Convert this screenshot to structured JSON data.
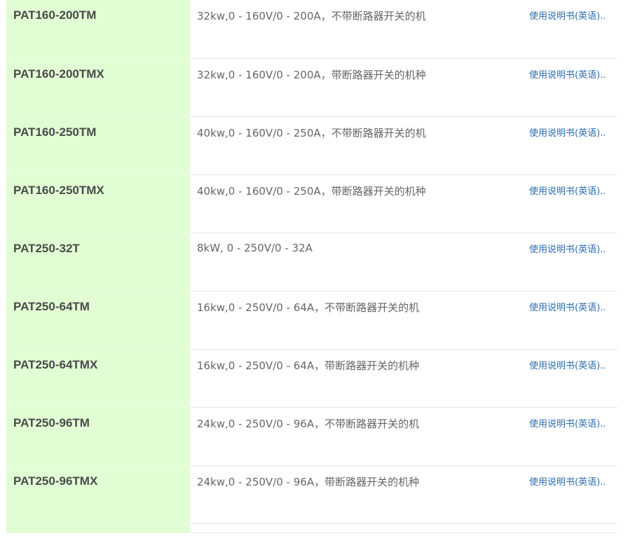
{
  "rows": [
    {
      "model": "PAT160-200TM",
      "spec": "32kw,0 - 160V/0 - 200A，不带断路器开关的机",
      "link": "使用说明书(英语).."
    },
    {
      "model": "PAT160-200TMX",
      "spec": "32kw,0 - 160V/0 - 200A，带断路器开关的机种",
      "link": "使用说明书(英语).."
    },
    {
      "model": "PAT160-250TM",
      "spec": "40kw,0 - 160V/0 - 250A，不带断路器开关的机",
      "link": "使用说明书(英语).."
    },
    {
      "model": "PAT160-250TMX",
      "spec": "40kw,0 - 160V/0 - 250A，带断路器开关的机种",
      "link": "使用说明书(英语).."
    },
    {
      "model": "PAT250-32T",
      "spec": "8kW, 0 - 250V/0 - 32A",
      "link": "使用说明书(英语).."
    },
    {
      "model": "PAT250-64TM",
      "spec": "16kw,0 - 250V/0 - 64A，不带断路器开关的机",
      "link": "使用说明书(英语).."
    },
    {
      "model": "PAT250-64TMX",
      "spec": "16kw,0 - 250V/0 - 64A，带断路器开关的机种",
      "link": "使用说明书(英语).."
    },
    {
      "model": "PAT250-96TM",
      "spec": "24kw,0 - 250V/0 - 96A，不带断路器开关的机",
      "link": "使用说明书(英语).."
    },
    {
      "model": "PAT250-96TMX",
      "spec": "24kw,0 - 250V/0 - 96A，带断路器开关的机种",
      "link": "使用说明书(英语).."
    }
  ]
}
